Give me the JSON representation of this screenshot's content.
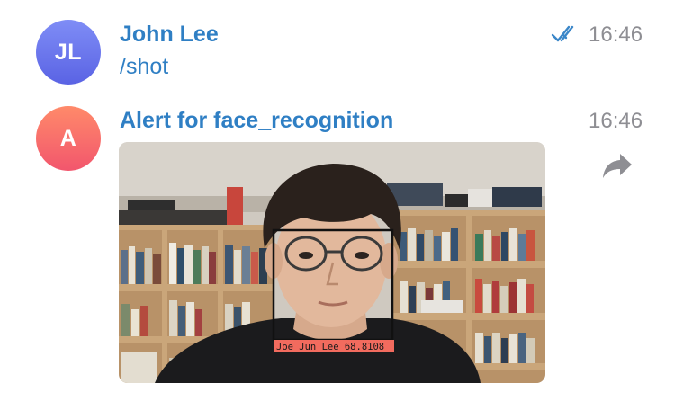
{
  "messages": [
    {
      "avatar_initials": "JL",
      "sender": "John Lee",
      "text": "/shot",
      "time": "16:46",
      "read_status_icon": "double-check-icon",
      "colors": {
        "avatar_top": "#7f8df6",
        "avatar_bottom": "#5a63e4"
      }
    },
    {
      "avatar_initials": "A",
      "sender": "Alert for face_recognition",
      "time": "16:46",
      "attachment": {
        "type": "photo",
        "face_box_label": "Joe Jun Lee 68.8108"
      },
      "forward_icon": "forward-arrow-icon",
      "colors": {
        "avatar_top": "#ff8a6a",
        "avatar_bottom": "#f2566d"
      }
    }
  ],
  "colors": {
    "sender_name": "#2f7fc4",
    "timestamp": "#8e8e93",
    "check_marks": "#3a86c8",
    "face_box": "#111111",
    "face_label_bg": "#f26b5e"
  }
}
